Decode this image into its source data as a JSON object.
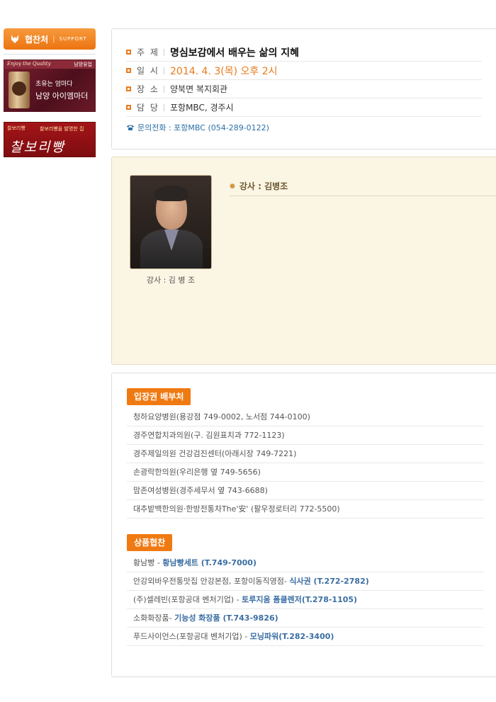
{
  "sidebar": {
    "support_label": "협찬처",
    "support_label_en": "SUPPORT",
    "banner1": {
      "tagline": "Enjoy the Quality",
      "brand_mini": "남양유업",
      "slogan": "초유는 엄마다",
      "product": "남양 아이엠마더"
    },
    "banner2": {
      "small_left": "찰보리빵",
      "small_right": "찰보리빵을 발명한 집",
      "big": "찰보리빵"
    }
  },
  "info": {
    "rows": [
      {
        "key": "주 제",
        "value": "명심보감에서 배우는 삶의 지혜"
      },
      {
        "key": "일 시",
        "value": "2014. 4. 3(목) 오후 2시"
      },
      {
        "key": "장 소",
        "value": "양북면 복지회관"
      },
      {
        "key": "담 당",
        "value": "포항MBC, 경주시"
      }
    ],
    "contact": "문의전화 : 포항MBC (054-289-0122)"
  },
  "lecturer": {
    "caption": "강사 : 김 병 조",
    "heading": "강사 : 김병조"
  },
  "distribution": {
    "title": "입장권 배부처",
    "items": [
      "청하요양병원(용강점 749-0002, 노서점 744-0100)",
      "경주연합치과의원(구. 김원표치과 772-1123)",
      "경주제일의원 건강검진센터(아래시장 749-7221)",
      "손광락한의원(우리은행 옆 749-5656)",
      "맘존여성병원(경주세무서 옆 743-6688)",
      "대추밭백한의원·한방전통차The'安' (팔우정로터리 772-5500)"
    ]
  },
  "sponsors": {
    "title": "상품협찬",
    "items": [
      {
        "prefix": "황남빵 - ",
        "highlight": "황남빵세트 (T.749-7000)"
      },
      {
        "prefix": "안강외바우전통맛집 안강본점, 포항이동직영점- ",
        "highlight": "식사권 (T.272-2782)"
      },
      {
        "prefix": "(주)셀레빈(포항공대 벤처기업) - ",
        "highlight": "토루지움 폼클렌저(T.278-1105)"
      },
      {
        "prefix": "소화화장품- ",
        "highlight": "기능성 화장품 (T.743-9826)"
      },
      {
        "prefix": "푸드사이언스(포항공대 벤처기업) - ",
        "highlight": "모닝파워(T.282-3400)"
      }
    ]
  }
}
